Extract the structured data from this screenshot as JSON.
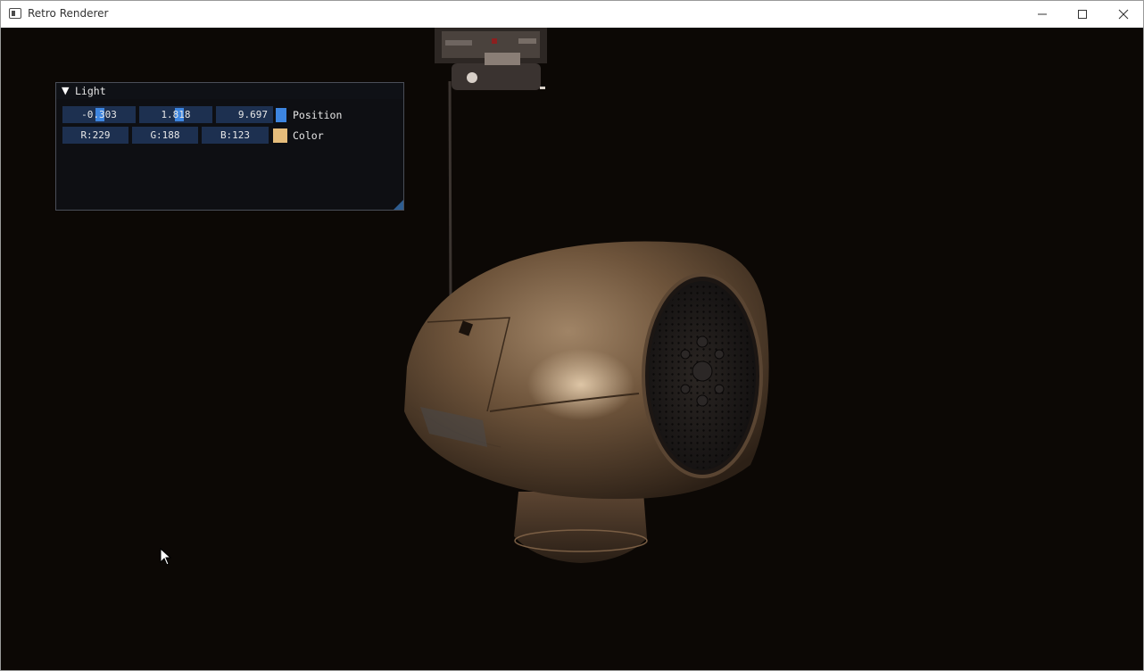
{
  "window": {
    "title": "Retro Renderer",
    "icon": "app-window-icon",
    "controls": {
      "minimize_icon": "minimize-icon",
      "maximize_icon": "maximize-icon",
      "close_icon": "close-icon"
    }
  },
  "light_panel": {
    "title": "Light",
    "collapse_icon": "collapse-triangle-icon",
    "position": {
      "label": "Position",
      "x": "-0.303",
      "y": "1.818",
      "z": "9.697",
      "swatch_color": "#3d85e0"
    },
    "color": {
      "label": "Color",
      "r": "R:229",
      "g": "G:188",
      "b": "B:123",
      "swatch_color": "#e5bc7b"
    }
  },
  "colors": {
    "viewport_background": "#0c0805",
    "panel_background": "#0f1014",
    "field_background": "#1d3050",
    "accent": "#3d85e0"
  }
}
